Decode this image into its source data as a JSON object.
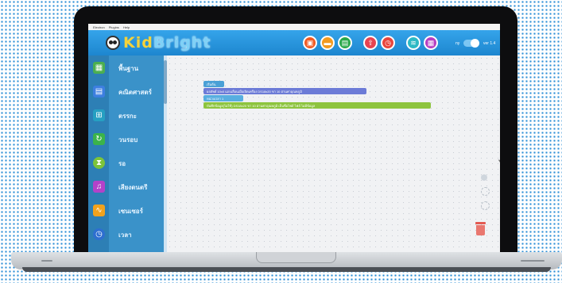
{
  "menubar": {
    "items": [
      "Electron",
      "Plugins",
      "Help"
    ]
  },
  "app": {
    "logo_text_kid": "Kid",
    "logo_text_bright": "Bright",
    "toolbar_buttons": [
      {
        "icon": "new-icon",
        "color": "#f25a22"
      },
      {
        "icon": "open-icon",
        "color": "#f29a1f"
      },
      {
        "icon": "save-icon",
        "color": "#2aa84a"
      },
      {
        "icon": "upload-icon",
        "color": "#e84351"
      },
      {
        "icon": "alarm-icon",
        "color": "#e8453c"
      },
      {
        "icon": "wifi-icon",
        "color": "#2cb9c5"
      },
      {
        "icon": "board-icon",
        "color": "#b63ec2"
      }
    ],
    "toggle_label": "ny",
    "version": "ver 1.4"
  },
  "sidebar": {
    "items": [
      {
        "label": "พื้นฐาน",
        "icon": "grid-icon",
        "color": "#4caf50"
      },
      {
        "label": "คณิตศาสตร์",
        "icon": "calculator-icon",
        "color": "#3d7fe0"
      },
      {
        "label": "ตรรกะ",
        "icon": "logic-icon",
        "color": "#26a0c2"
      },
      {
        "label": "วนรอบ",
        "icon": "loop-icon",
        "color": "#3bb34a"
      },
      {
        "label": "รอ",
        "icon": "wait-icon",
        "color": "#7cc43a"
      },
      {
        "label": "เสียงดนตรี",
        "icon": "music-icon",
        "color": "#b342c9"
      },
      {
        "label": "เซนเซอร์",
        "icon": "sensor-icon",
        "color": "#f2a21c"
      },
      {
        "label": "เวลา",
        "icon": "clock-icon",
        "color": "#2e6fd0"
      }
    ]
  },
  "workspace": {
    "blocks": [
      {
        "text": "เริ่มต้น"
      },
      {
        "text": "ผลลัพธ์ 10x0 แถบเลื่อนเมื่อเปิดเครื่อง   DS18x20 ขา 10  อ่านค่าอุณหภูมิ"
      },
      {
        "text": "หน่วงเวลา 1"
      },
      {
        "text": "บันทึกข้อมูล(ไม่ใช้)   DS18x20 ขา 10  อ่านค่าอุณหภูมิ   เป็นชื่อไฟล์  ไฟล์ ไม่มีข้อมูล"
      }
    ]
  }
}
